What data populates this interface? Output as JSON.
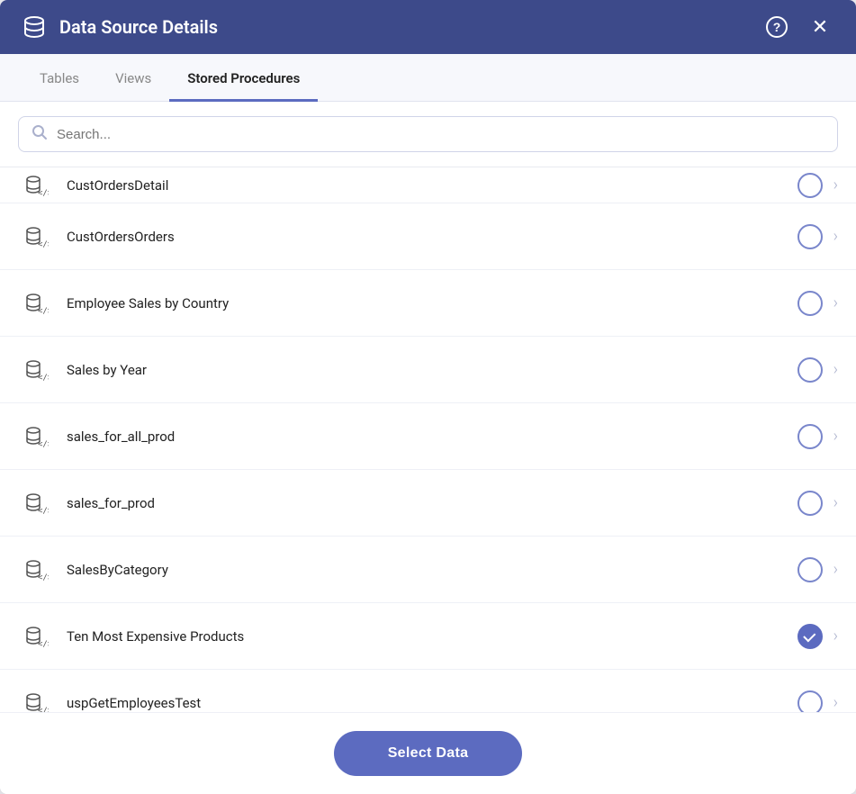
{
  "header": {
    "title": "Data Source Details",
    "help_label": "?",
    "close_label": "×"
  },
  "tabs": [
    {
      "label": "Tables",
      "active": false
    },
    {
      "label": "Views",
      "active": false
    },
    {
      "label": "Stored Procedures",
      "active": true
    }
  ],
  "search": {
    "placeholder": "Search..."
  },
  "procedures": [
    {
      "name": "CustOrdersDetail",
      "checked": false,
      "partial": true
    },
    {
      "name": "CustOrdersOrders",
      "checked": false,
      "partial": false
    },
    {
      "name": "Employee Sales by Country",
      "checked": false,
      "partial": false
    },
    {
      "name": "Sales by Year",
      "checked": false,
      "partial": false
    },
    {
      "name": "sales_for_all_prod",
      "checked": false,
      "partial": false
    },
    {
      "name": "sales_for_prod",
      "checked": false,
      "partial": false
    },
    {
      "name": "SalesByCategory",
      "checked": false,
      "partial": false
    },
    {
      "name": "Ten Most Expensive Products",
      "checked": true,
      "partial": false
    },
    {
      "name": "uspGetEmployeesTest",
      "checked": false,
      "partial": false
    }
  ],
  "footer": {
    "select_label": "Select Data"
  }
}
